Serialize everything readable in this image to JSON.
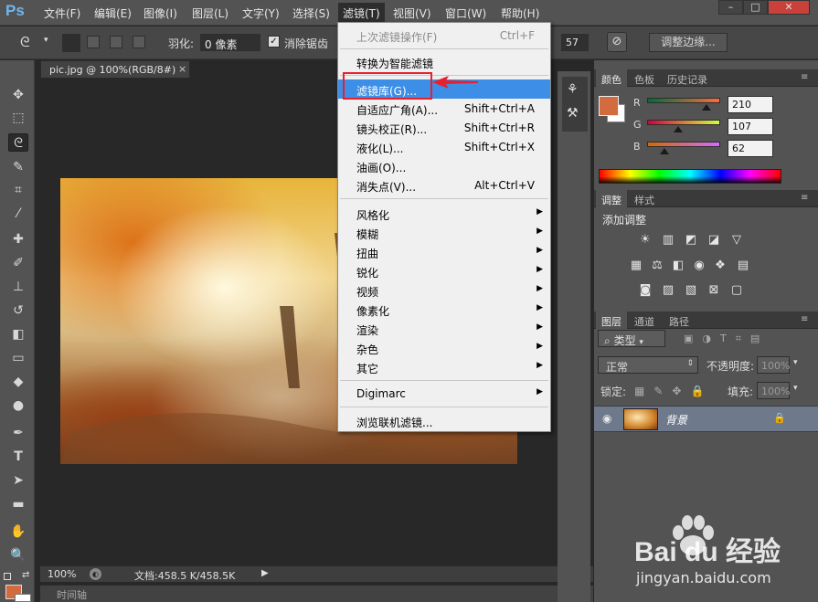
{
  "app": {
    "logo": "Ps",
    "menus": [
      "文件(F)",
      "编辑(E)",
      "图像(I)",
      "图层(L)",
      "文字(Y)",
      "选择(S)",
      "滤镜(T)",
      "视图(V)",
      "窗口(W)",
      "帮助(H)"
    ],
    "active_menu": "滤镜(T)",
    "window_controls": [
      "–",
      "□",
      "✕"
    ]
  },
  "options": {
    "feather_label": "羽化:",
    "feather_value": "0 像素",
    "antialias_label": "消除锯齿",
    "antialias_checked": true,
    "width_value": "57",
    "refine_edge_label": "调整边缘..."
  },
  "document": {
    "tab_title": "pic.jpg @ 100%(RGB/8#)",
    "tab_close": "×",
    "zoom": "100%",
    "doc_size": "文档:458.5 K/458.5K",
    "timeline_label": "时间轴"
  },
  "filter_menu": {
    "items": [
      {
        "label": "上次滤镜操作(F)",
        "shortcut": "Ctrl+F",
        "disabled": true
      },
      {
        "label": "转换为智能滤镜",
        "shortcut": ""
      },
      {
        "label": "滤镜库(G)...",
        "shortcut": "",
        "highlighted": true
      },
      {
        "label": "自适应广角(A)...",
        "shortcut": "Shift+Ctrl+A"
      },
      {
        "label": "镜头校正(R)...",
        "shortcut": "Shift+Ctrl+R"
      },
      {
        "label": "液化(L)...",
        "shortcut": "Shift+Ctrl+X"
      },
      {
        "label": "油画(O)...",
        "shortcut": ""
      },
      {
        "label": "消失点(V)...",
        "shortcut": "Alt+Ctrl+V"
      },
      {
        "label": "风格化",
        "submenu": true
      },
      {
        "label": "模糊",
        "submenu": true
      },
      {
        "label": "扭曲",
        "submenu": true
      },
      {
        "label": "锐化",
        "submenu": true
      },
      {
        "label": "视频",
        "submenu": true
      },
      {
        "label": "像素化",
        "submenu": true
      },
      {
        "label": "渲染",
        "submenu": true
      },
      {
        "label": "杂色",
        "submenu": true
      },
      {
        "label": "其它",
        "submenu": true
      },
      {
        "label": "Digimarc",
        "submenu": true
      },
      {
        "label": "浏览联机滤镜..."
      }
    ]
  },
  "color_panel": {
    "tabs": [
      "颜色",
      "色板",
      "历史记录"
    ],
    "active_tab": "颜色",
    "channels": [
      {
        "name": "R",
        "value": "210"
      },
      {
        "name": "G",
        "value": "107"
      },
      {
        "name": "B",
        "value": "62"
      }
    ],
    "swatch_color": "#d26b3e"
  },
  "adjust_panel": {
    "tabs": [
      "调整",
      "样式"
    ],
    "active_tab": "调整",
    "heading": "添加调整"
  },
  "layers_panel": {
    "tabs": [
      "图层",
      "通道",
      "路径"
    ],
    "active_tab": "图层",
    "filter_label": "类型",
    "blend_mode": "正常",
    "opacity_label": "不透明度:",
    "opacity_value": "100%",
    "lock_label": "锁定:",
    "fill_label": "填充:",
    "fill_value": "100%",
    "layers": [
      {
        "name": "背景",
        "visible": true,
        "locked": true
      }
    ]
  },
  "watermark": {
    "brand": "Bai du 经验",
    "url": "jingyan.baidu.com"
  },
  "colors": {
    "menu_highlight": "#3d8ee6",
    "annotation_red": "#e8202b",
    "foreground": "#d26b3e"
  }
}
